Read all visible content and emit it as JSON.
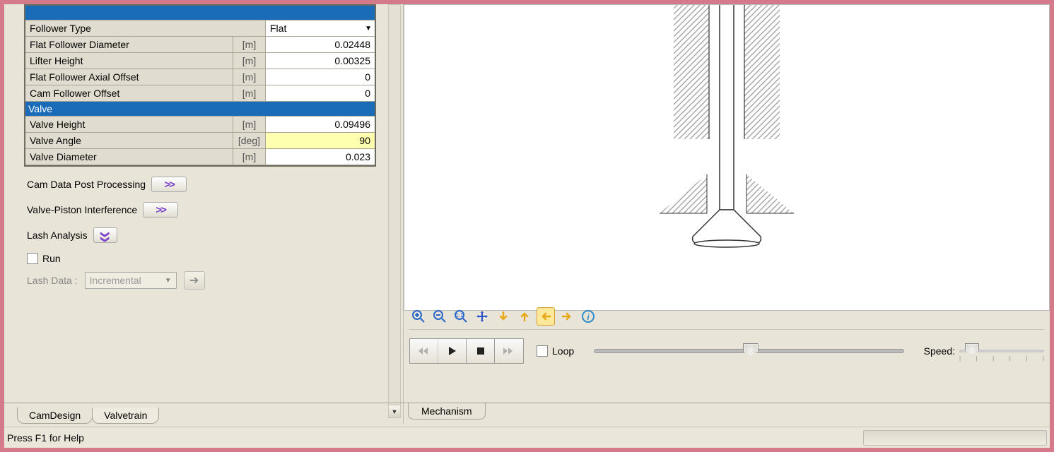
{
  "propertyTable": {
    "groups": [
      {
        "type": "header",
        "label": ""
      },
      {
        "type": "row",
        "label": "Follower Type",
        "unit": "",
        "value": "Flat",
        "select": true
      },
      {
        "type": "row",
        "label": "Flat Follower Diameter",
        "unit": "[m]",
        "value": "0.02448"
      },
      {
        "type": "row",
        "label": "Lifter Height",
        "unit": "[m]",
        "value": "0.00325"
      },
      {
        "type": "row",
        "label": "Flat Follower Axial Offset",
        "unit": "[m]",
        "value": "0"
      },
      {
        "type": "row",
        "label": "Cam Follower Offset",
        "unit": "[m]",
        "value": "0"
      },
      {
        "type": "header",
        "label": "Valve"
      },
      {
        "type": "row",
        "label": "Valve Height",
        "unit": "[m]",
        "value": "0.09496"
      },
      {
        "type": "row",
        "label": "Valve Angle",
        "unit": "[deg]",
        "value": "90",
        "highlight": true
      },
      {
        "type": "row",
        "label": "Valve Diameter",
        "unit": "[m]",
        "value": "0.023"
      }
    ]
  },
  "actions": {
    "camData": "Cam Data Post Processing",
    "valvePiston": "Valve-Piston Interference",
    "lashAnalysis": "Lash Analysis",
    "run": "Run",
    "lashData": "Lash Data :",
    "lashMode": "Incremental"
  },
  "playback": {
    "loop": "Loop",
    "speed": "Speed:"
  },
  "tabs": {
    "mechanism": "Mechanism",
    "camDesign": "CamDesign",
    "valvetrain": "Valvetrain"
  },
  "status": "Press F1 for Help"
}
